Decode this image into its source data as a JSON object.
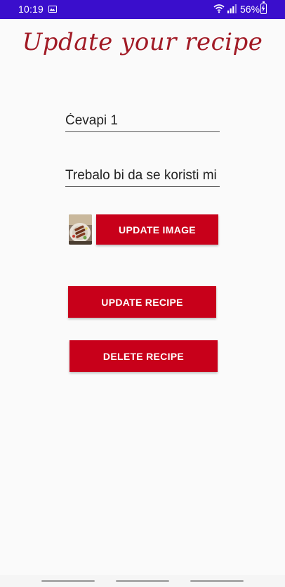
{
  "status_bar": {
    "time": "10:19",
    "battery": "56%",
    "background_color": "#3a0ecc",
    "icons": [
      "gallery-icon",
      "wifi-icon",
      "signal-icon",
      "battery-icon"
    ]
  },
  "header": {
    "title": "Update your recipe",
    "title_color": "#a11a25"
  },
  "form": {
    "name_value": "Ćevapi 1",
    "description_value": "Trebalo bi da se koristi mi",
    "update_image_label": "UPDATE IMAGE",
    "update_recipe_label": "UPDATE RECIPE",
    "delete_recipe_label": "DELETE RECIPE",
    "button_color": "#c8001a"
  }
}
